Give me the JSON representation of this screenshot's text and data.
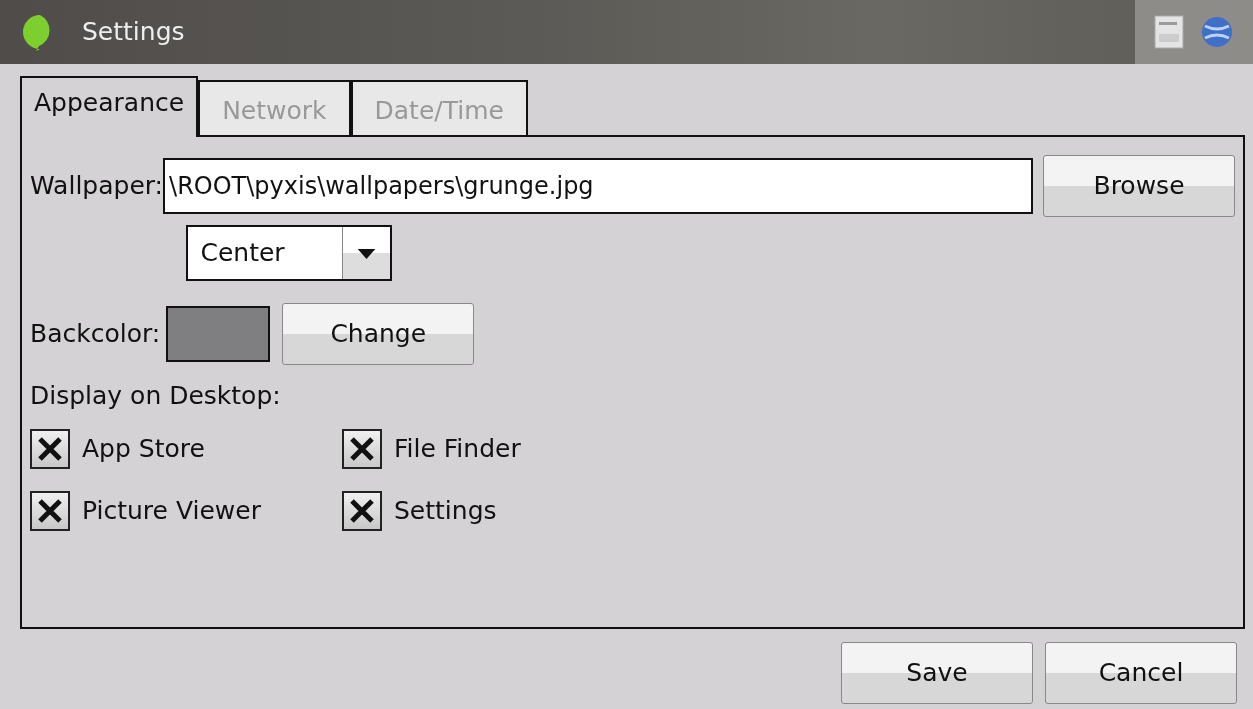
{
  "window": {
    "title": "Settings"
  },
  "tabs": [
    {
      "label": "Appearance",
      "selected": true
    },
    {
      "label": "Network",
      "selected": false
    },
    {
      "label": "Date/Time",
      "selected": false
    }
  ],
  "wallpaper": {
    "label": "Wallpaper:",
    "value": "\\ROOT\\pyxis\\wallpapers\\grunge.jpg",
    "browse_button": "Browse",
    "mode": "Center"
  },
  "backcolor": {
    "label": "Backcolor:",
    "color": "#7f7e80",
    "change_button": "Change"
  },
  "display": {
    "label": "Display on Desktop:",
    "items": [
      {
        "label": "App Store",
        "checked": true
      },
      {
        "label": "File Finder",
        "checked": true
      },
      {
        "label": "Picture Viewer",
        "checked": true
      },
      {
        "label": "Settings",
        "checked": true
      }
    ]
  },
  "buttons": [
    "Save",
    "Cancel"
  ]
}
